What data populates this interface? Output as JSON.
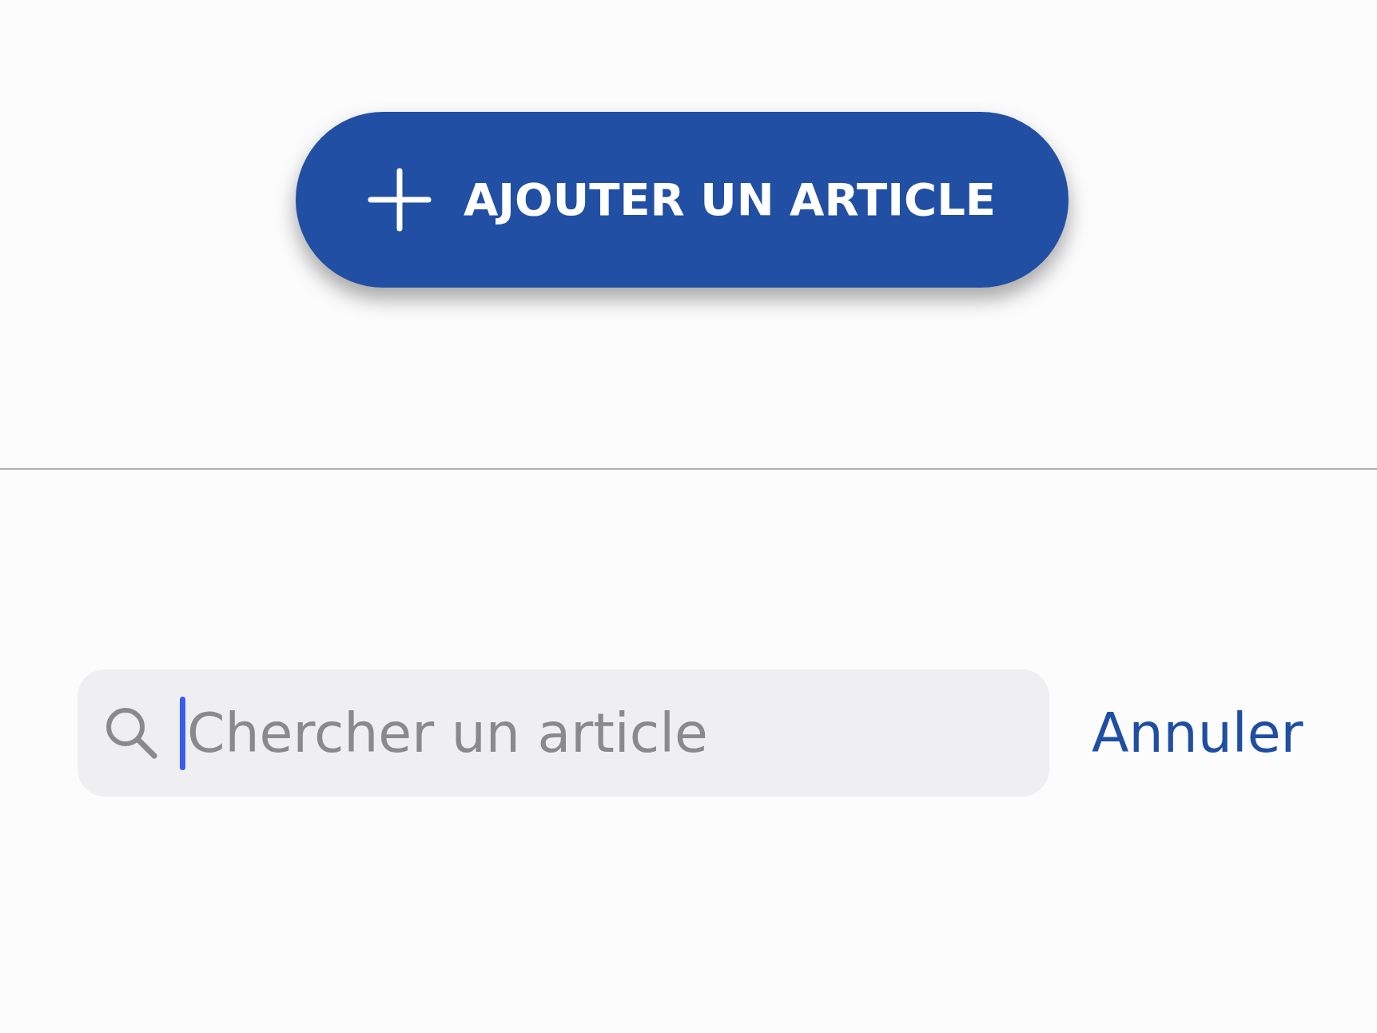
{
  "add_button": {
    "label": "AJOUTER UN ARTICLE"
  },
  "search": {
    "placeholder": "Chercher un article",
    "focused": true
  },
  "cancel_link": "Annuler"
}
